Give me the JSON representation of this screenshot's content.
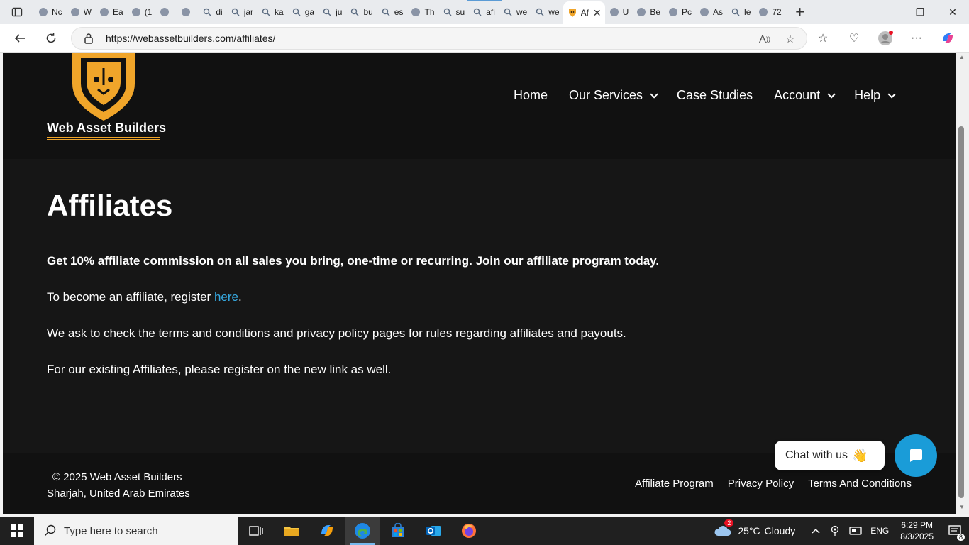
{
  "browser": {
    "tabs": [
      {
        "label": "Nc",
        "icon": "chart-icon"
      },
      {
        "label": "W",
        "icon": "chatgpt-icon"
      },
      {
        "label": "Ea",
        "icon": "notion-icon"
      },
      {
        "label": "(1",
        "icon": "b-icon"
      },
      {
        "label": "",
        "icon": "puzzle-icon"
      },
      {
        "label": "",
        "icon": "badge-icon"
      },
      {
        "label": "di",
        "icon": "search-icon"
      },
      {
        "label": "jar",
        "icon": "search-icon"
      },
      {
        "label": "ka",
        "icon": "search-icon"
      },
      {
        "label": "ga",
        "icon": "search-icon"
      },
      {
        "label": "ju",
        "icon": "search-icon"
      },
      {
        "label": "bu",
        "icon": "search-icon"
      },
      {
        "label": "es",
        "icon": "search-icon"
      },
      {
        "label": "Th",
        "icon": "castle-icon"
      },
      {
        "label": "su",
        "icon": "search-icon"
      },
      {
        "label": "afi",
        "icon": "search-icon"
      },
      {
        "label": "we",
        "icon": "search-icon"
      },
      {
        "label": "we",
        "icon": "search-icon"
      }
    ],
    "active_tab": {
      "label": "Af",
      "icon": "lion-icon"
    },
    "tabs_after": [
      {
        "label": "U",
        "icon": "globe-icon"
      },
      {
        "label": "Be",
        "icon": "avatar-icon"
      },
      {
        "label": "Pc",
        "icon": "xf-icon"
      },
      {
        "label": "As",
        "icon": "layers-icon"
      },
      {
        "label": "le",
        "icon": "search-icon"
      },
      {
        "label": "72",
        "icon": "settings-icon"
      }
    ],
    "url": "https://webassetbuilders.com/affiliates/"
  },
  "site": {
    "logo_text": "Web Asset Builders",
    "nav": [
      {
        "label": "Home",
        "dropdown": false
      },
      {
        "label": "Our Services",
        "dropdown": true
      },
      {
        "label": "Case Studies",
        "dropdown": false
      },
      {
        "label": "Account",
        "dropdown": true
      },
      {
        "label": "Help",
        "dropdown": true
      }
    ],
    "title": "Affiliates",
    "intro": "Get 10% affiliate commission on all sales you bring, one-time or recurring. Join our affiliate program today.",
    "register_prefix": "To become an affiliate, register ",
    "register_link": "here",
    "register_suffix": ".",
    "terms_text": "We ask to check the terms and conditions and privacy policy pages for rules regarding affiliates and payouts.",
    "existing_text": "For our existing Affiliates, please register on the new link as well.",
    "footer": {
      "copyright": "© 2025 Web Asset Builders",
      "location": "Sharjah, United Arab Emirates",
      "links": [
        "Affiliate Program",
        "Privacy Policy",
        "Terms And Conditions"
      ]
    },
    "chat_label": "Chat with us",
    "chat_emoji": "👋"
  },
  "taskbar": {
    "search_placeholder": "Type here to search",
    "weather_temp": "25°C",
    "weather_desc": "Cloudy",
    "weather_badge": "2",
    "language": "ENG",
    "time": "6:29 PM",
    "date": "8/3/2025",
    "notification_count": "8"
  },
  "colors": {
    "accent": "#1a9cd8",
    "link": "#36a9e1",
    "logo_gold": "#f0a52a",
    "page_bg": "#161616"
  }
}
